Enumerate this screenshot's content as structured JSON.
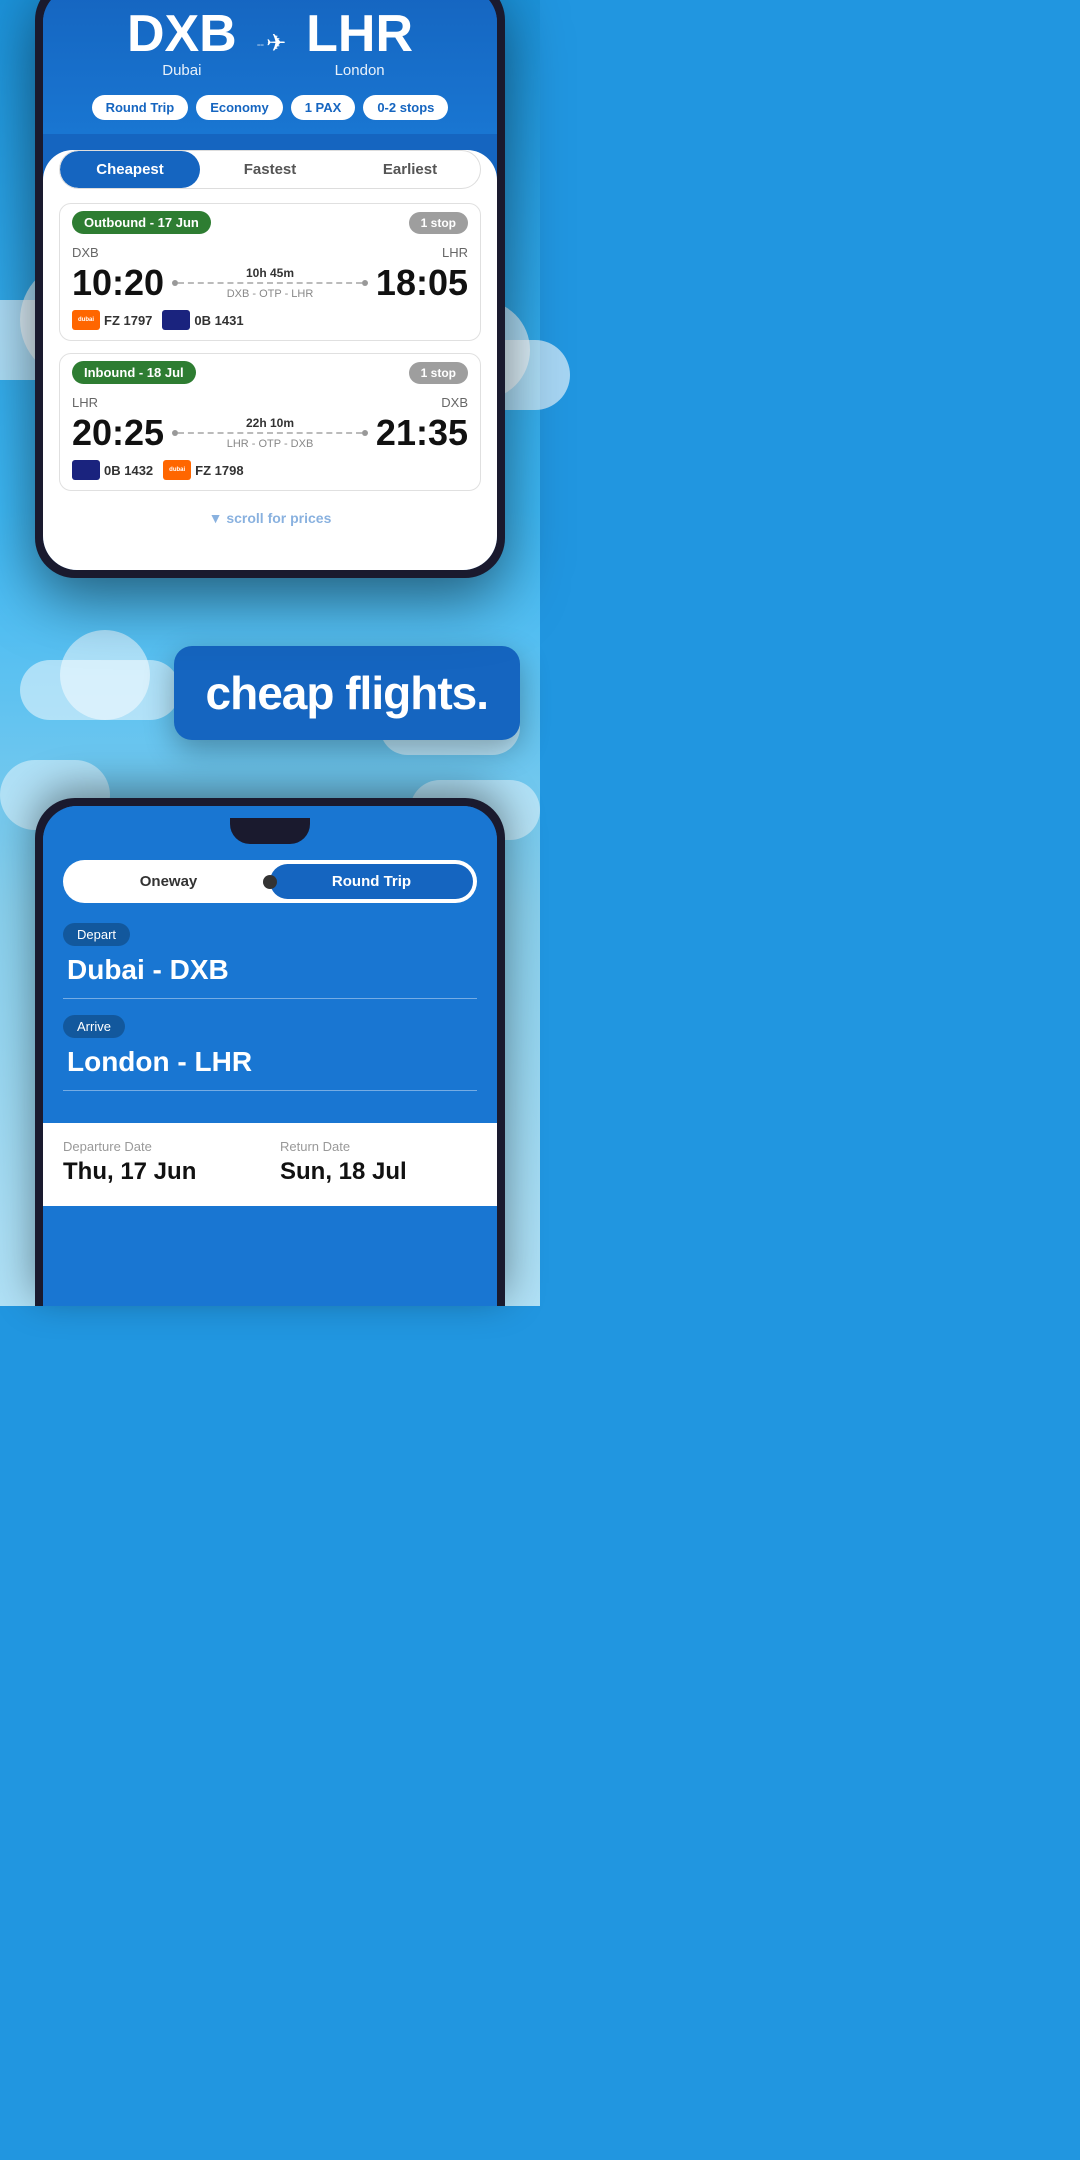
{
  "app": {
    "tagline": "cheap flights."
  },
  "phone1": {
    "route": {
      "origin_code": "DXB",
      "origin_name": "Dubai",
      "dest_code": "LHR",
      "dest_name": "London"
    },
    "filters": {
      "trip_type": "Round Trip",
      "cabin": "Economy",
      "pax": "1 PAX",
      "stops": "0-2 stops"
    },
    "tabs": {
      "cheapest": "Cheapest",
      "fastest": "Fastest",
      "earliest": "Earliest",
      "active": "cheapest"
    },
    "outbound": {
      "label": "Outbound - 17 Jun",
      "stop_badge": "1 stop",
      "origin": "DXB",
      "destination": "LHR",
      "depart_time": "10:20",
      "arrive_time": "18:05",
      "duration": "10h 45m",
      "route": "DXB - OTP - LHR",
      "airline1_code": "FZ 1797",
      "airline1_logo": "dubai",
      "airline2_code": "0B 1431",
      "airline2_logo": "blue"
    },
    "inbound": {
      "label": "Inbound - 18 Jul",
      "stop_badge": "1 stop",
      "origin": "LHR",
      "destination": "DXB",
      "depart_time": "20:25",
      "arrive_time": "21:35",
      "duration": "22h 10m",
      "route": "LHR - OTP - DXB",
      "airline1_code": "0B 1432",
      "airline1_logo": "blue",
      "airline2_code": "FZ 1798",
      "airline2_logo": "dubai"
    }
  },
  "phone2": {
    "trip_toggle": {
      "oneway": "Oneway",
      "roundtrip": "Round Trip",
      "active": "roundtrip"
    },
    "depart": {
      "label": "Depart",
      "value": "Dubai - DXB"
    },
    "arrive": {
      "label": "Arrive",
      "value": "London - LHR"
    },
    "departure_date": {
      "label": "Departure Date",
      "value": "Thu, 17 Jun"
    },
    "return_date": {
      "label": "Return Date",
      "value": "Sun, 18 Jul"
    }
  }
}
